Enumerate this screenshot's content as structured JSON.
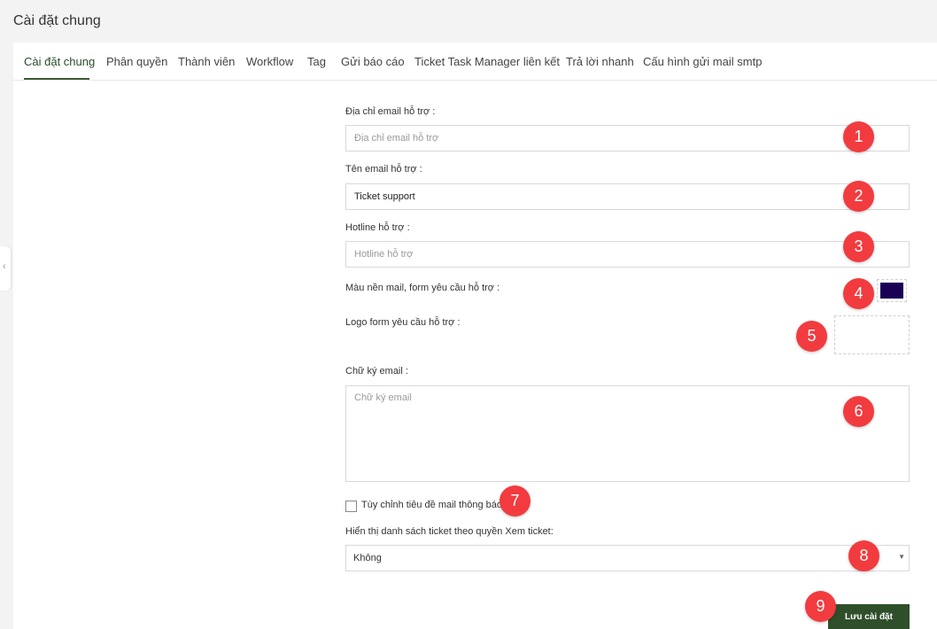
{
  "page": {
    "title": "Cài đặt chung"
  },
  "tabs": [
    {
      "label": "Cài đặt chung",
      "active": true
    },
    {
      "label": "Phân quyền"
    },
    {
      "label": "Thành viên"
    },
    {
      "label": "Workflow"
    },
    {
      "label": "Tag"
    },
    {
      "label": "Gửi báo cáo"
    },
    {
      "label": "Ticket Task Manager liên kết"
    },
    {
      "label": "Trả lời nhanh"
    },
    {
      "label": "Cấu hình gửi mail smtp"
    }
  ],
  "form": {
    "support_email": {
      "label": "Địa chỉ email hỗ trợ :",
      "placeholder": "Địa chỉ email hỗ trợ",
      "value": ""
    },
    "support_email_name": {
      "label": "Tên email hỗ trợ :",
      "value": "Ticket support"
    },
    "hotline": {
      "label": "Hotline hỗ trợ :",
      "placeholder": "Hotline hỗ trợ",
      "value": ""
    },
    "background_color": {
      "label": "Màu nền mail, form yêu cầu hỗ trợ :",
      "color": "#1a0055"
    },
    "logo": {
      "label": "Logo form yêu cầu hỗ trợ :"
    },
    "signature": {
      "label": "Chữ ký email :",
      "placeholder": "Chữ ký email"
    },
    "custom_subject": {
      "label": "Tùy chỉnh tiêu đề mail thông báo",
      "checked": false
    },
    "ticket_list_view": {
      "label": "Hiển thị danh sách ticket theo quyền Xem ticket:",
      "selected": "Không"
    },
    "save_label": "Lưu cài đặt"
  },
  "annotations": [
    "1",
    "2",
    "3",
    "4",
    "5",
    "6",
    "7",
    "8",
    "9"
  ],
  "colors": {
    "accent": "#2f4f2b",
    "badge": "#f23b3f",
    "swatch": "#1a0055"
  }
}
